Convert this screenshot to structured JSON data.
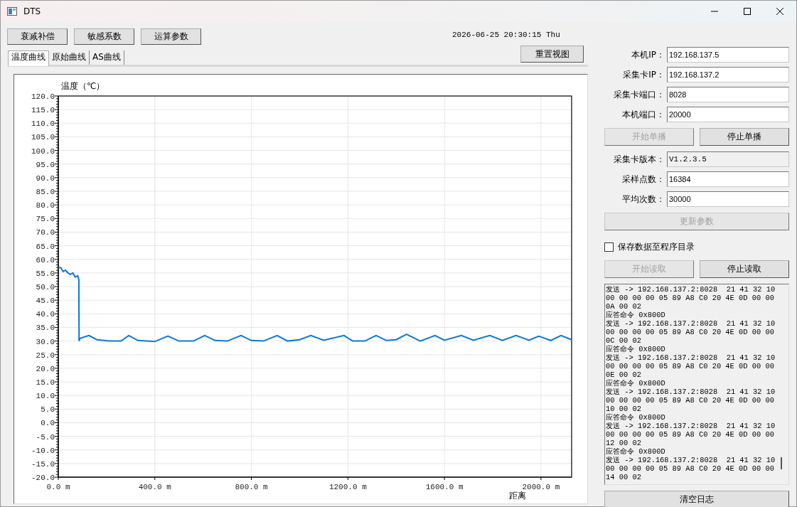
{
  "window": {
    "title": "DTS"
  },
  "toolbar": {
    "buttons": [
      {
        "label": "衰减补偿"
      },
      {
        "label": "敏感系数"
      },
      {
        "label": "运算参数"
      }
    ],
    "datetime": "2026-06-25 20:30:15 Thu"
  },
  "tabs": [
    {
      "label": "温度曲线",
      "selected": true
    },
    {
      "label": "原始曲线",
      "selected": false
    },
    {
      "label": "AS曲线",
      "selected": false
    }
  ],
  "reset_button": "重置视图",
  "chart": {
    "chart_data": {
      "type": "line",
      "xlabel": "距离",
      "ylabel": "温度（℃）",
      "x": [
        0,
        10,
        20,
        30,
        40,
        50,
        60,
        70,
        80,
        85,
        86,
        90,
        127,
        160,
        210,
        260,
        292,
        330,
        400,
        454,
        500,
        560,
        607,
        650,
        700,
        757,
        800,
        850,
        907,
        950,
        1000,
        1046,
        1100,
        1184,
        1220,
        1270,
        1317,
        1360,
        1400,
        1443,
        1500,
        1561,
        1600,
        1670,
        1720,
        1788,
        1840,
        1897,
        1950,
        1991,
        2040,
        2083,
        2127
      ],
      "grid": true,
      "series": [
        {
          "color": "#0a78d7",
          "values": [
            57,
            57,
            55.5,
            56,
            55,
            54.5,
            55,
            53.5,
            54,
            52.5,
            30,
            31,
            32,
            30.5,
            30,
            30,
            32,
            30.2,
            29.8,
            31.8,
            30,
            30,
            32,
            30.2,
            30,
            32,
            30.2,
            30,
            32,
            30,
            30.5,
            32,
            30.3,
            32,
            30,
            30,
            32,
            30.2,
            30.5,
            32.5,
            30,
            32,
            30.3,
            32,
            30.3,
            32,
            30.2,
            32,
            30.3,
            31.8,
            30.2,
            32,
            30.5
          ]
        }
      ],
      "xlim": [
        0,
        2127
      ],
      "ylim": [
        -20,
        120
      ],
      "xticks": [
        {
          "value": 0,
          "label": "0.0 m"
        },
        {
          "value": 400,
          "label": "400.0 m"
        },
        {
          "value": 800,
          "label": "800.0 m"
        },
        {
          "value": 1200,
          "label": "1200.0 m"
        },
        {
          "value": 1600,
          "label": "1600.0 m"
        },
        {
          "value": 2000,
          "label": "2000.0 m"
        }
      ],
      "yticks": [
        {
          "value": 120,
          "label": "120.0"
        },
        {
          "value": 115,
          "label": "115.0"
        },
        {
          "value": 110,
          "label": "110.0"
        },
        {
          "value": 105,
          "label": "105.0"
        },
        {
          "value": 100,
          "label": "100.0"
        },
        {
          "value": 95,
          "label": "95.0"
        },
        {
          "value": 90,
          "label": "90.0"
        },
        {
          "value": 85,
          "label": "85.0"
        },
        {
          "value": 80,
          "label": "80.0"
        },
        {
          "value": 75,
          "label": "75.0"
        },
        {
          "value": 70,
          "label": "70.0"
        },
        {
          "value": 65,
          "label": "65.0"
        },
        {
          "value": 60,
          "label": "60.0"
        },
        {
          "value": 55,
          "label": "55.0"
        },
        {
          "value": 50,
          "label": "50.0"
        },
        {
          "value": 45,
          "label": "45.0"
        },
        {
          "value": 40,
          "label": "40.0"
        },
        {
          "value": 35,
          "label": "35.0"
        },
        {
          "value": 30,
          "label": "30.0"
        },
        {
          "value": 25,
          "label": "25.0"
        },
        {
          "value": 20,
          "label": "20.0"
        },
        {
          "value": 15,
          "label": "15.0"
        },
        {
          "value": 10,
          "label": "10.0"
        },
        {
          "value": 5,
          "label": "5.0"
        },
        {
          "value": 0,
          "label": "0.0"
        },
        {
          "value": -5,
          "label": "-5.0"
        },
        {
          "value": -10,
          "label": "-10.0"
        },
        {
          "value": -15,
          "label": "-15.0"
        },
        {
          "value": -20,
          "label": "-20.0"
        }
      ]
    }
  },
  "panel": [
    {
      "kind": "field",
      "label": "本机IP：",
      "value": "192.168.137.5",
      "readonly": false
    },
    {
      "kind": "field",
      "label": "采集卡IP：",
      "value": "192.168.137.2",
      "readonly": false
    },
    {
      "kind": "field",
      "label": "采集卡端口：",
      "value": "8028",
      "readonly": false
    },
    {
      "kind": "field",
      "label": "本机端口：",
      "value": "20000",
      "readonly": false
    },
    {
      "kind": "buttons",
      "buttons": [
        {
          "label": "开始单播",
          "disabled": true
        },
        {
          "label": "停止单播",
          "disabled": false
        }
      ]
    },
    {
      "kind": "field",
      "label": "采集卡版本：",
      "value": "V1.2.3.5",
      "readonly": true
    },
    {
      "kind": "field",
      "label": "采样点数：",
      "value": "16384",
      "readonly": false
    },
    {
      "kind": "field",
      "label": "平均次数：",
      "value": "30000",
      "readonly": false
    },
    {
      "kind": "buttons",
      "buttons": [
        {
          "label": "更新参数",
          "disabled": true
        }
      ]
    },
    {
      "kind": "checkbox",
      "label": "保存数据至程序目录",
      "checked": false
    },
    {
      "kind": "buttons",
      "buttons": [
        {
          "label": "开始读取",
          "disabled": true
        },
        {
          "label": "停止读取",
          "disabled": false
        }
      ]
    },
    {
      "kind": "log",
      "lines": [
        "发送 -> 192.168.137.2:8028  21 41 32 10",
        "00 00 00 00 05 89 A8 C0 20 4E 0D 00 00",
        "0A 00 02",
        "应答命令 0x800D",
        "发送 -> 192.168.137.2:8028  21 41 32 10",
        "00 00 00 00 05 89 A8 C0 20 4E 0D 00 00",
        "0C 00 02",
        "应答命令 0x800D",
        "发送 -> 192.168.137.2:8028  21 41 32 10",
        "00 00 00 00 05 89 A8 C0 20 4E 0D 00 00",
        "0E 00 02",
        "应答命令 0x800D",
        "发送 -> 192.168.137.2:8028  21 41 32 10",
        "00 00 00 00 05 89 A8 C0 20 4E 0D 00 00",
        "10 00 02",
        "应答命令 0x800D",
        "发送 -> 192.168.137.2:8028  21 41 32 10",
        "00 00 00 00 05 89 A8 C0 20 4E 0D 00 00",
        "12 00 02",
        "应答命令 0x800D",
        "发送 -> 192.168.137.2:8028  21 41 32 10",
        "00 00 00 00 05 89 A8 C0 20 4E 0D 00 00",
        "14 00 02"
      ]
    },
    {
      "kind": "buttons",
      "buttons": [
        {
          "label": "清空日志",
          "disabled": false
        }
      ]
    }
  ]
}
